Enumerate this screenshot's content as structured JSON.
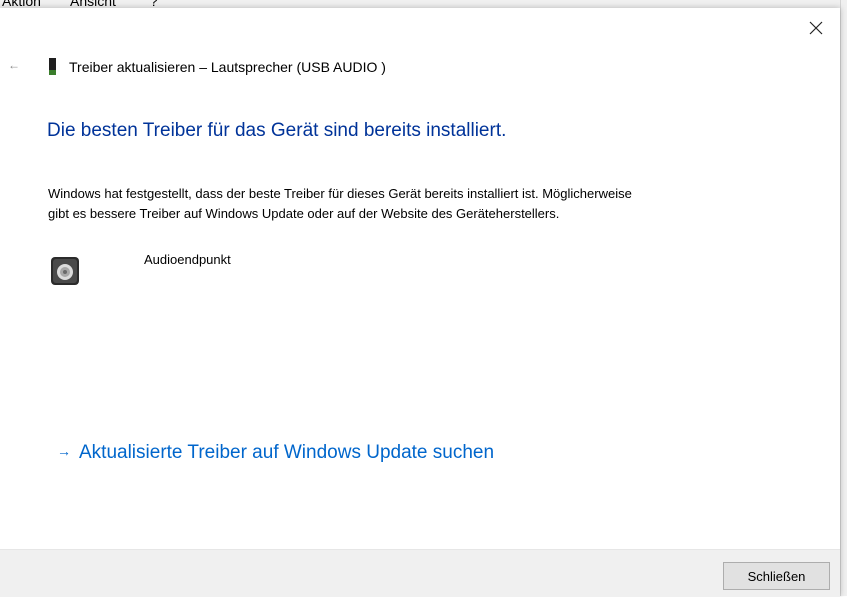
{
  "background_menu": {
    "items": [
      "Aktion",
      "Ansicht",
      "?"
    ]
  },
  "dialog": {
    "window_title": "Treiber aktualisieren – Lautsprecher (USB  AUDIO  )",
    "heading": "Die besten Treiber für das Gerät sind bereits installiert.",
    "description_line1": "Windows hat festgestellt, dass der beste Treiber für dieses Gerät bereits installiert ist. Möglicherweise",
    "description_line2": "gibt es bessere Treiber auf Windows Update oder auf der Website des Geräteherstellers.",
    "device_name": "Audioendpunkt",
    "update_link": "Aktualisierte Treiber auf Windows Update suchen",
    "close_button": "Schließen"
  },
  "icons": {
    "close": "close-icon",
    "back": "back-arrow-icon",
    "title": "usb-device-icon",
    "device": "speaker-icon",
    "link_arrow": "arrow-right-icon"
  },
  "colors": {
    "heading": "#003399",
    "link": "#0066cc",
    "footer": "#f0f0f0"
  }
}
